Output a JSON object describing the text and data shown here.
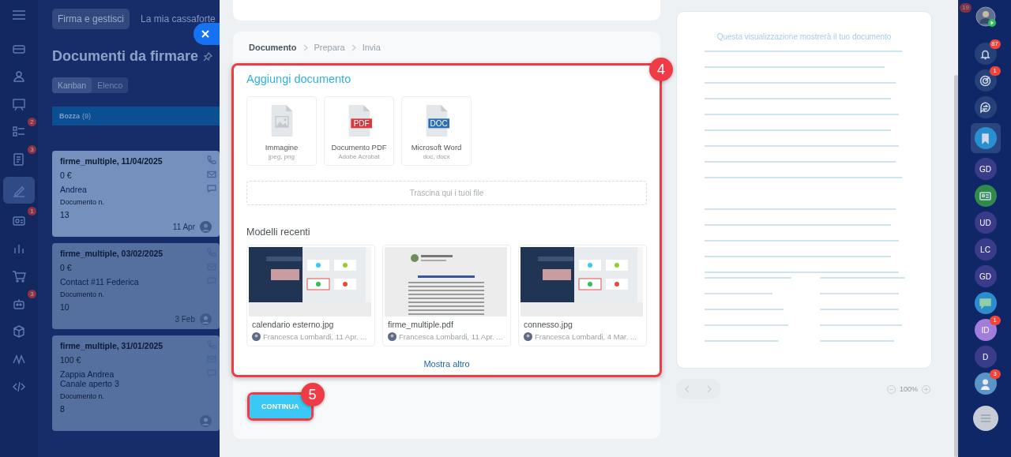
{
  "top_tabs": [
    {
      "label": "Firma e gestisci",
      "selected": true
    },
    {
      "label": "La mia cassaforte",
      "selected": false
    }
  ],
  "top_badge": "19",
  "left_nav": [
    {
      "kind": "card",
      "selected": false
    },
    {
      "kind": "people",
      "selected": false
    },
    {
      "kind": "board",
      "selected": false
    },
    {
      "kind": "tasks",
      "selected": false,
      "badge": "2"
    },
    {
      "kind": "notes",
      "selected": false,
      "badge": "3"
    },
    {
      "kind": "sign",
      "selected": true
    },
    {
      "kind": "contact",
      "selected": false,
      "badge": "1"
    },
    {
      "kind": "chart",
      "selected": false
    },
    {
      "kind": "cart",
      "selected": false
    },
    {
      "kind": "robot",
      "selected": false,
      "badge": "3"
    },
    {
      "kind": "cube",
      "selected": false
    },
    {
      "kind": "wave",
      "selected": false
    },
    {
      "kind": "code",
      "selected": false
    }
  ],
  "page": {
    "title": "Documenti da firmare",
    "views": [
      {
        "label": "Kanban",
        "selected": true
      },
      {
        "label": "Elenco",
        "selected": false
      }
    ],
    "column": {
      "name": "Bozza",
      "count": "(9)"
    },
    "cards": [
      {
        "title": "firme_multiple, 11/04/2025",
        "amount": "0 €",
        "contacts": [
          "Andrea"
        ],
        "doc_label": "Documento n.",
        "doc_number": "13",
        "date": "11 Apr",
        "highlighted": true
      },
      {
        "title": "firme_multiple, 03/02/2025",
        "amount": "0 €",
        "contacts": [
          "Contact #11 Federica"
        ],
        "doc_label": "Documento n.",
        "doc_number": "10",
        "date": "3 Feb",
        "highlighted": false
      },
      {
        "title": "firme_multiple, 31/01/2025",
        "amount": "100 €",
        "contacts": [
          "Zappia Andrea",
          "Canale aperto 3"
        ],
        "doc_label": "Documento n.",
        "doc_number": "8",
        "highlighted": false
      }
    ]
  },
  "slider": {
    "steps": [
      {
        "label": "Documento",
        "selected": true
      },
      {
        "label": "Prepara",
        "selected": false
      },
      {
        "label": "Invia",
        "selected": false
      }
    ],
    "add_title": "Aggiungi documento",
    "file_types": [
      {
        "kind": "image",
        "name": "Immagine",
        "formats": "jpeg, png"
      },
      {
        "kind": "pdf",
        "name": "Documento PDF",
        "formats": "Adobe Acrobat",
        "tag": "PDF"
      },
      {
        "kind": "doc",
        "name": "Microsoft Word",
        "formats": "doc, docx",
        "tag": "DOC"
      }
    ],
    "drop_zone": "Trascina qui i tuoi file",
    "recent_title": "Modelli recenti",
    "recent": [
      {
        "kind": "app",
        "name": "calendario esterno.jpg",
        "author": "Francesca Lombardi, 11 Apr. ..."
      },
      {
        "kind": "letter",
        "name": "firme_multiple.pdf",
        "author": "Francesca Lombardi, 11 Apr. ..."
      },
      {
        "kind": "app",
        "name": "connesso.jpg",
        "author": "Francesca Lombardi, 4 Mar. ..."
      }
    ],
    "show_more": "Mostra altro",
    "continue": "CONTINUA",
    "callouts": [
      "4",
      "5"
    ]
  },
  "preview": {
    "caption": "Questa visualizzazione mostrerà il tuo documento",
    "zoom": "100%"
  },
  "right_nav": [
    {
      "kind": "bell",
      "badge": "87",
      "selected": false
    },
    {
      "kind": "target",
      "badge": "1",
      "selected": false
    },
    {
      "kind": "swap",
      "selected": false
    },
    {
      "kind": "bookmark",
      "selected": true,
      "color": "#2a8fd0"
    },
    {
      "kind": "initials",
      "text": "GD",
      "color": "#3a3c8a",
      "selected": false
    },
    {
      "kind": "contact",
      "color": "#2f8a4c",
      "selected": false
    },
    {
      "kind": "initials",
      "text": "UD",
      "color": "#3a3c8a",
      "selected": false
    },
    {
      "kind": "initials",
      "text": "LC",
      "color": "#3a3c8a",
      "selected": false
    },
    {
      "kind": "initials",
      "text": "GD",
      "color": "#3a3c8a",
      "selected": false
    },
    {
      "kind": "chat",
      "color": "#2d8ccb",
      "selected": false
    },
    {
      "kind": "initials",
      "text": "ID",
      "color": "#a27ddc",
      "badge": "1",
      "selected": false
    },
    {
      "kind": "initials",
      "text": "D",
      "color": "#3a3c8a",
      "selected": false
    },
    {
      "kind": "avatar",
      "badge": "3",
      "color": "#5a95c8",
      "selected": false
    }
  ]
}
